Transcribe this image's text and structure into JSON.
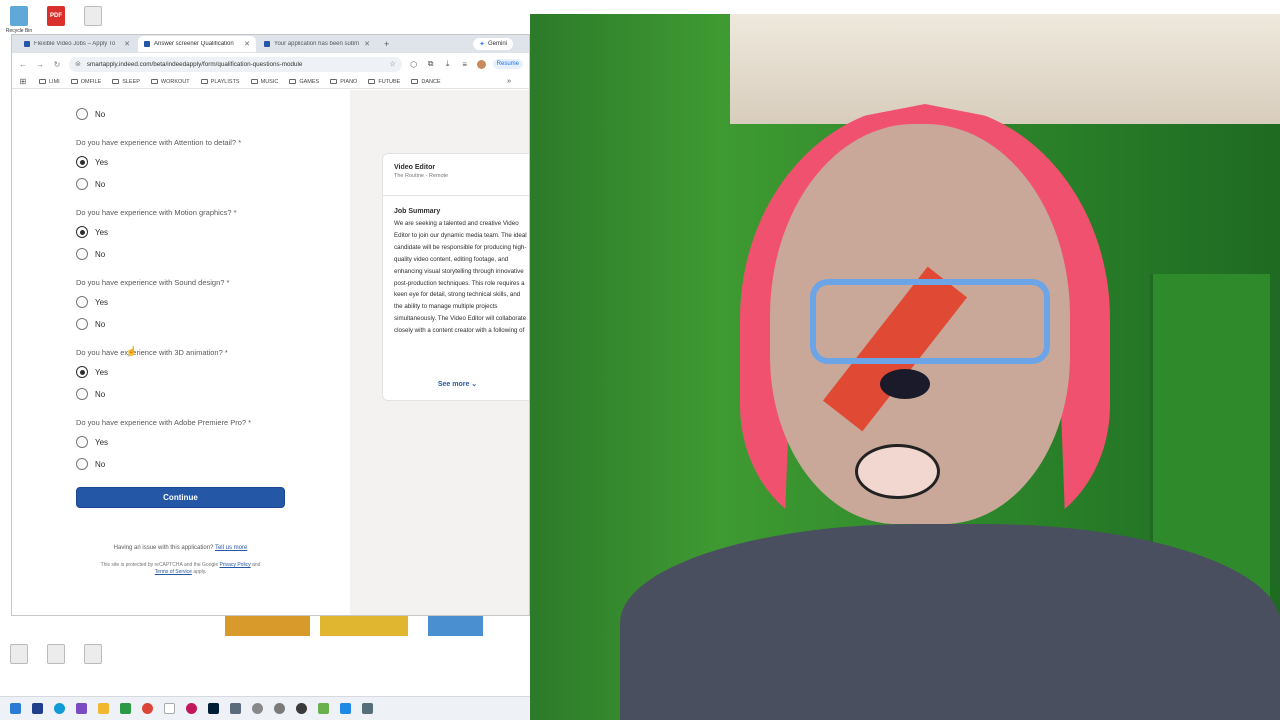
{
  "desktop": {
    "icons_top": [
      {
        "label": "Recycle Bin",
        "glyph": "recycle",
        "icon": "recycle-bin-icon"
      },
      {
        "label": "",
        "glyph": "PDF",
        "icon": "pdf-file-icon"
      },
      {
        "label": "",
        "glyph": "",
        "icon": "document-icon"
      }
    ],
    "icons_bottom": [
      {
        "label": "",
        "icon": "document-icon"
      },
      {
        "label": "",
        "icon": "document-icon"
      },
      {
        "label": "",
        "icon": "document-icon"
      }
    ]
  },
  "browser": {
    "tabs": [
      {
        "title": "Flexible Video Jobs – Apply To",
        "active": false
      },
      {
        "title": "Answer screener Qualification",
        "active": true
      },
      {
        "title": "Your application has been subm",
        "active": false
      }
    ],
    "new_tab": "+",
    "gemini_label": "Gemini",
    "url": "smartapply.indeed.com/beta/indeedapply/form/qualification-questions-module",
    "resume_label": "Resume",
    "bookmarks": [
      "LIMI",
      "OMFILE",
      "SLEEP",
      "WORKOUT",
      "PLAYLISTS",
      "MUSIC",
      "GAMES",
      "PIANO",
      "FUTUBE",
      "DANCE"
    ],
    "bookmarks_more": "»"
  },
  "form": {
    "top_partial_option": "No",
    "questions": [
      {
        "question": "Do you have experience with Attention to detail? *",
        "yes": "Yes",
        "no": "No",
        "selected": "yes"
      },
      {
        "question": "Do you have experience with Motion graphics? *",
        "yes": "Yes",
        "no": "No",
        "selected": "yes"
      },
      {
        "question": "Do you have experience with Sound design? *",
        "yes": "Yes",
        "no": "No",
        "selected": ""
      },
      {
        "question": "Do you have experience with 3D animation? *",
        "yes": "Yes",
        "no": "No",
        "selected": "yes"
      },
      {
        "question": "Do you have experience with Adobe Premiere Pro? *",
        "yes": "Yes",
        "no": "No",
        "selected": ""
      }
    ],
    "continue_label": "Continue",
    "issue_text": "Having an issue with this application?",
    "issue_link": "Tell us more",
    "legal_prefix": "This site is protected by reCAPTCHA and the Google",
    "privacy_link": "Privacy Policy",
    "legal_and": "and",
    "terms_link": "Terms of Service",
    "legal_suffix": "apply."
  },
  "job": {
    "title": "Video Editor",
    "company": "The Routine - Remote",
    "summary_heading": "Job Summary",
    "summary": "We are seeking a talented and creative Video Editor to join our dynamic media team. The ideal candidate will be responsible for producing high-quality video content, editing footage, and enhancing visual storytelling through innovative post-production techniques. This role requires a keen eye for detail, strong technical skills, and the ability to manage multiple projects simultaneously. The Video Editor will collaborate closely with a content creator with a following of",
    "see_more": "See more ⌄"
  },
  "colors": {
    "indeed_blue": "#2557a7",
    "wall_green": "#2f8a2c",
    "hair_pink": "#f0516f"
  }
}
